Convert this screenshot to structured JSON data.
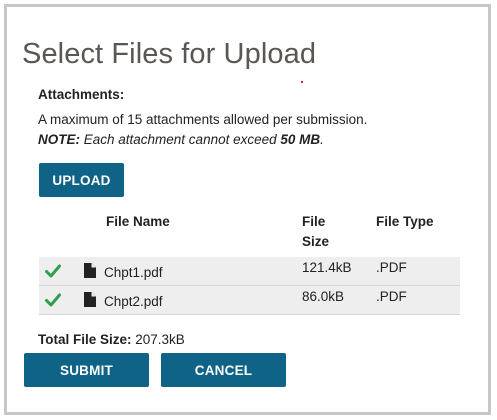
{
  "dialog": {
    "title": "Select Files for Upload",
    "attachments_label": "Attachments:",
    "max_text": "A maximum of 15 attachments allowed per submission.",
    "note_prefix": "NOTE:",
    "note_text": " Each attachment cannot exceed ",
    "note_limit": "50 MB",
    "note_suffix": "."
  },
  "upload_button": "UPLOAD",
  "table": {
    "headers": {
      "name": "File Name",
      "size_line1": "File",
      "size_line2": "Size",
      "type": "File Type"
    },
    "rows": [
      {
        "name": "Chpt1.pdf",
        "size": "121.4kB",
        "type": ".PDF",
        "status_icon": "check-icon",
        "file_icon": "file-icon"
      },
      {
        "name": "Chpt2.pdf",
        "size": "86.0kB",
        "type": ".PDF",
        "status_icon": "check-icon",
        "file_icon": "file-icon"
      }
    ]
  },
  "total": {
    "label": "Total File Size:",
    "value": " 207.3kB"
  },
  "actions": {
    "submit": "SUBMIT",
    "cancel": "CANCEL"
  },
  "colors": {
    "button": "#0e6387",
    "check": "#2e9e4f",
    "row_bg": "#eeeeee"
  }
}
